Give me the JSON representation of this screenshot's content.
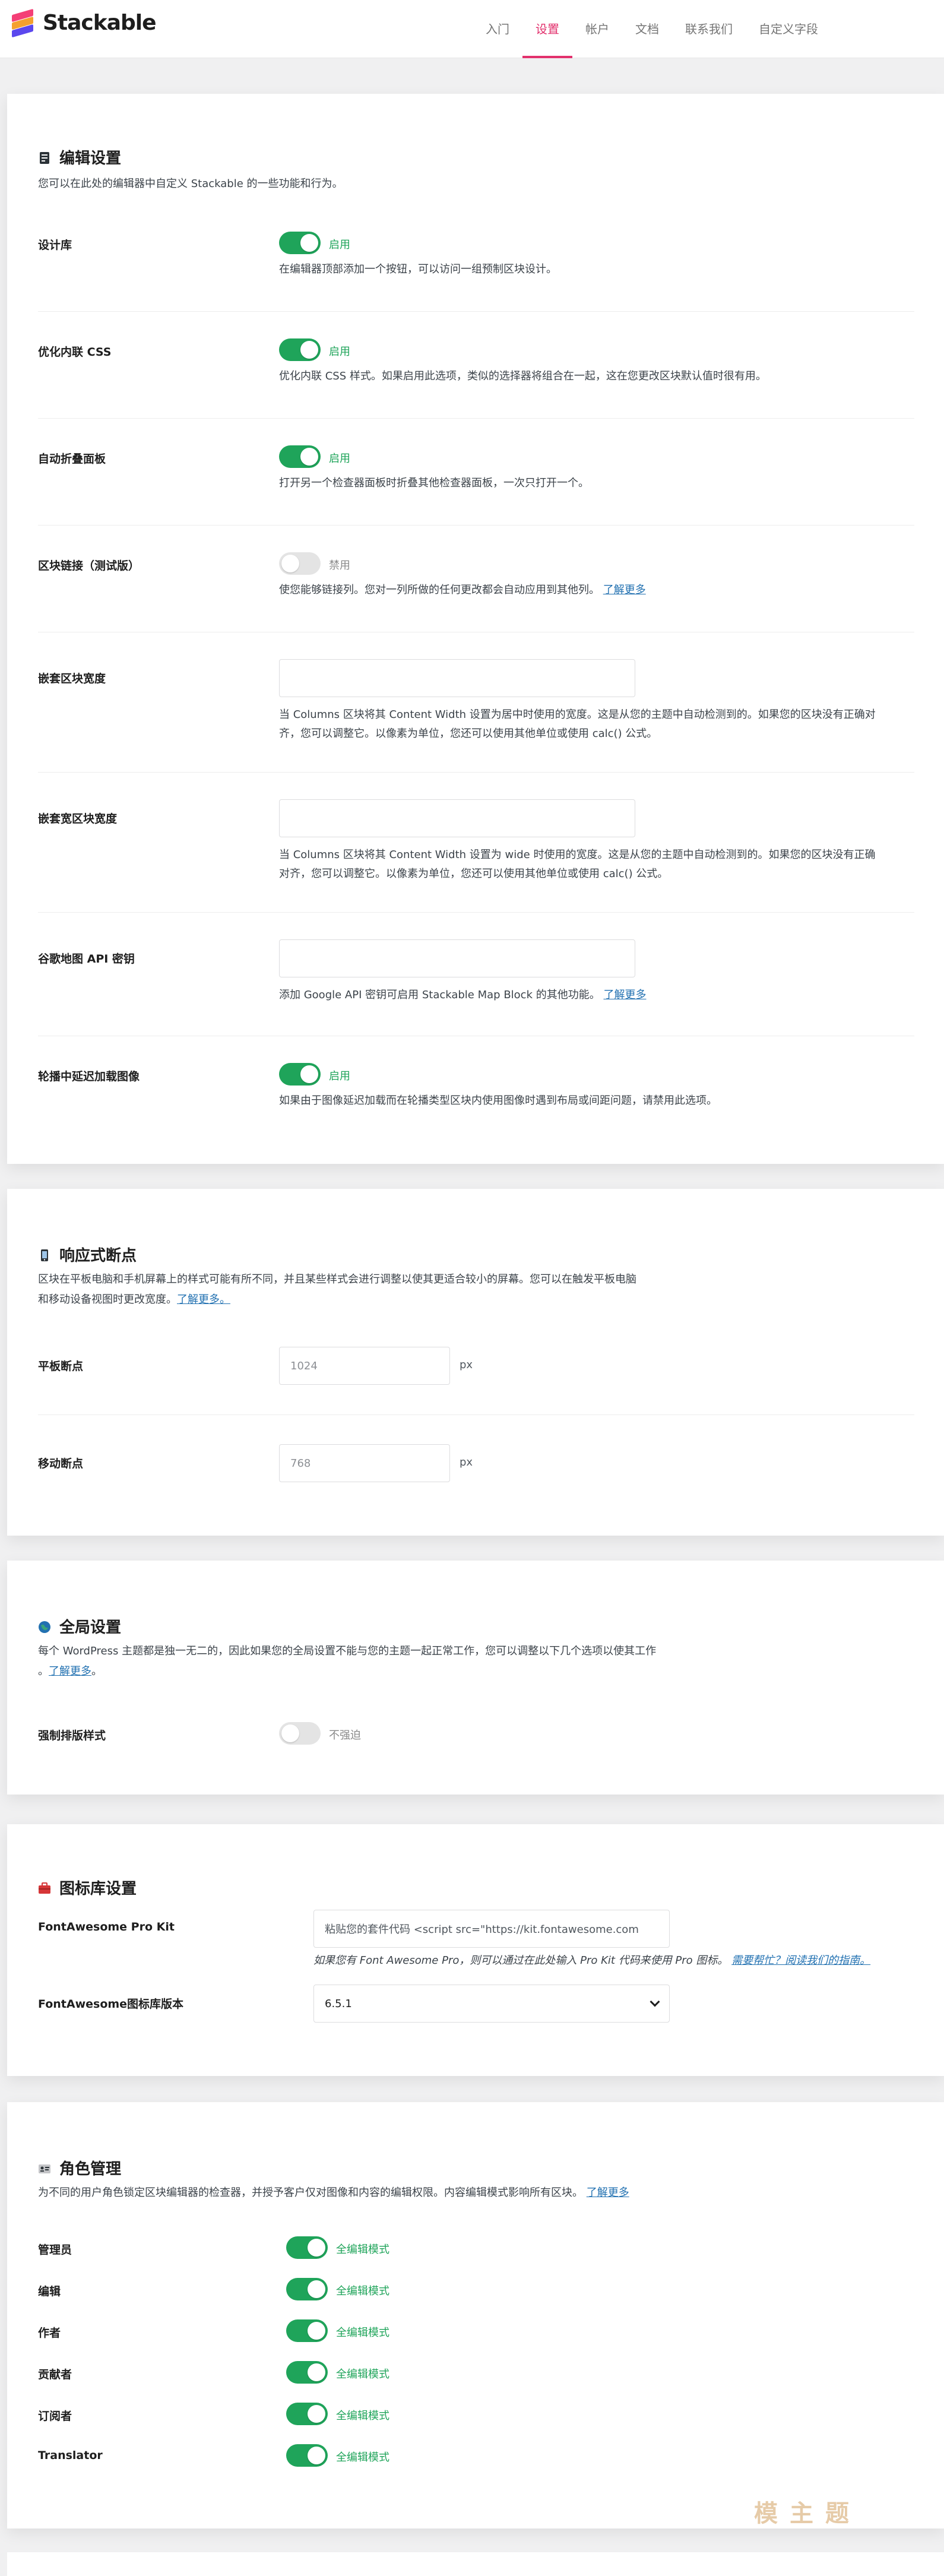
{
  "app": {
    "logo_text": "Stackable"
  },
  "nav": {
    "tabs": [
      "入门",
      "设置",
      "帐户",
      "文档",
      "联系我们",
      "自定义字段"
    ]
  },
  "editor_settings": {
    "title": "编辑设置",
    "description": "您可以在此处的编辑器中自定义 Stackable 的一些功能和行为。",
    "rows": [
      {
        "label": "设计库",
        "toggle": true,
        "state": "启用",
        "desc": "在编辑器顶部添加一个按钮，可以访问一组预制区块设计。"
      },
      {
        "label": "优化内联 CSS",
        "toggle": true,
        "state": "启用",
        "desc": "优化内联 CSS 样式。如果启用此选项，类似的选择器将组合在一起，这在您更改区块默认值时很有用。"
      },
      {
        "label": "自动折叠面板",
        "toggle": true,
        "state": "启用",
        "desc": "打开另一个检查器面板时折叠其他检查器面板，一次只打开一个。"
      },
      {
        "label": "区块链接（测试版）",
        "toggle": false,
        "state": "禁用",
        "desc": "使您能够链接列。您对一列所做的任何更改都会自动应用到其他列。",
        "link": "了解更多"
      },
      {
        "label": "嵌套区块宽度",
        "input": "",
        "desc1": "当 Columns 区块将其 Content Width 设置为居中时使用的宽度。这是从您的主题中自动检测到的。如果您的区块没有正确对",
        "desc2": "齐，您可以调整它。以像素为单位，您还可以使用其他单位或使用 calc() 公式。"
      },
      {
        "label": "嵌套宽区块宽度",
        "input": "",
        "desc1": "当 Columns 区块将其 Content Width 设置为 wide 时使用的宽度。这是从您的主题中自动检测到的。如果您的区块没有正确",
        "desc2": "对齐，您可以调整它。以像素为单位，您还可以使用其他单位或使用 calc() 公式。"
      },
      {
        "label": "谷歌地图 API 密钥",
        "input": "",
        "desc": "添加 Google API 密钥可启用 Stackable Map Block 的其他功能。",
        "link": "了解更多"
      },
      {
        "label": "轮播中延迟加载图像",
        "toggle": true,
        "state": "启用",
        "desc": "如果由于图像延迟加载而在轮播类型区块内使用图像时遇到布局或间距问题，请禁用此选项。"
      }
    ]
  },
  "responsive": {
    "title": "响应式断点",
    "desc1": "区块在平板电脑和手机屏幕上的样式可能有所不同，并且某些样式会进行调整以使其更适合较小的屏幕。您可以在触发平板电脑",
    "desc2": "和移动设备视图时更改宽度。",
    "link": "了解更多。",
    "tablet": {
      "label": "平板断点",
      "placeholder": "1024",
      "unit": "px"
    },
    "mobile": {
      "label": "移动断点",
      "placeholder": "768",
      "unit": "px"
    }
  },
  "global": {
    "title": "全局设置",
    "desc1": "每个 WordPress 主题都是独一无二的，因此如果您的全局设置不能与您的主题一起正常工作，您可以调整以下几个选项以使其工作",
    "desc2": "。",
    "link": "了解更多",
    "desc2_end": "。",
    "force_label": "强制排版样式",
    "force_state": "不强迫"
  },
  "icon_library": {
    "title": "图标库设置",
    "kit_label": "FontAwesome Pro Kit",
    "kit_placeholder": "粘贴您的套件代码 <script src=\"https://kit.fontawesome.com",
    "kit_help": "如果您有 Font Awesome Pro，则可以通过在此处输入 Pro Kit 代码来使用 Pro 图标。",
    "kit_help_link": "需要帮忙？阅读我们的指南。",
    "version_label": "FontAwesome图标库版本",
    "version_value": "6.5.1"
  },
  "roles": {
    "title": "角色管理",
    "desc": "为不同的用户角色锁定区块编辑器的检查器，并授予客户仅对图像和内容的编辑权限。内容编辑模式影响所有区块。",
    "link": "了解更多",
    "items": [
      {
        "label": "管理员",
        "state": "全编辑模式"
      },
      {
        "label": "编辑",
        "state": "全编辑模式"
      },
      {
        "label": "作者",
        "state": "全编辑模式"
      },
      {
        "label": "贡献者",
        "state": "全编辑模式"
      },
      {
        "label": "订阅者",
        "state": "全编辑模式"
      },
      {
        "label": "Translator",
        "state": "全编辑模式"
      }
    ]
  },
  "watermark": {
    "text": "模主题"
  },
  "colors": {
    "accent": "#e2316d",
    "toggle_on": "#1fa45a",
    "link": "#2271b1"
  }
}
